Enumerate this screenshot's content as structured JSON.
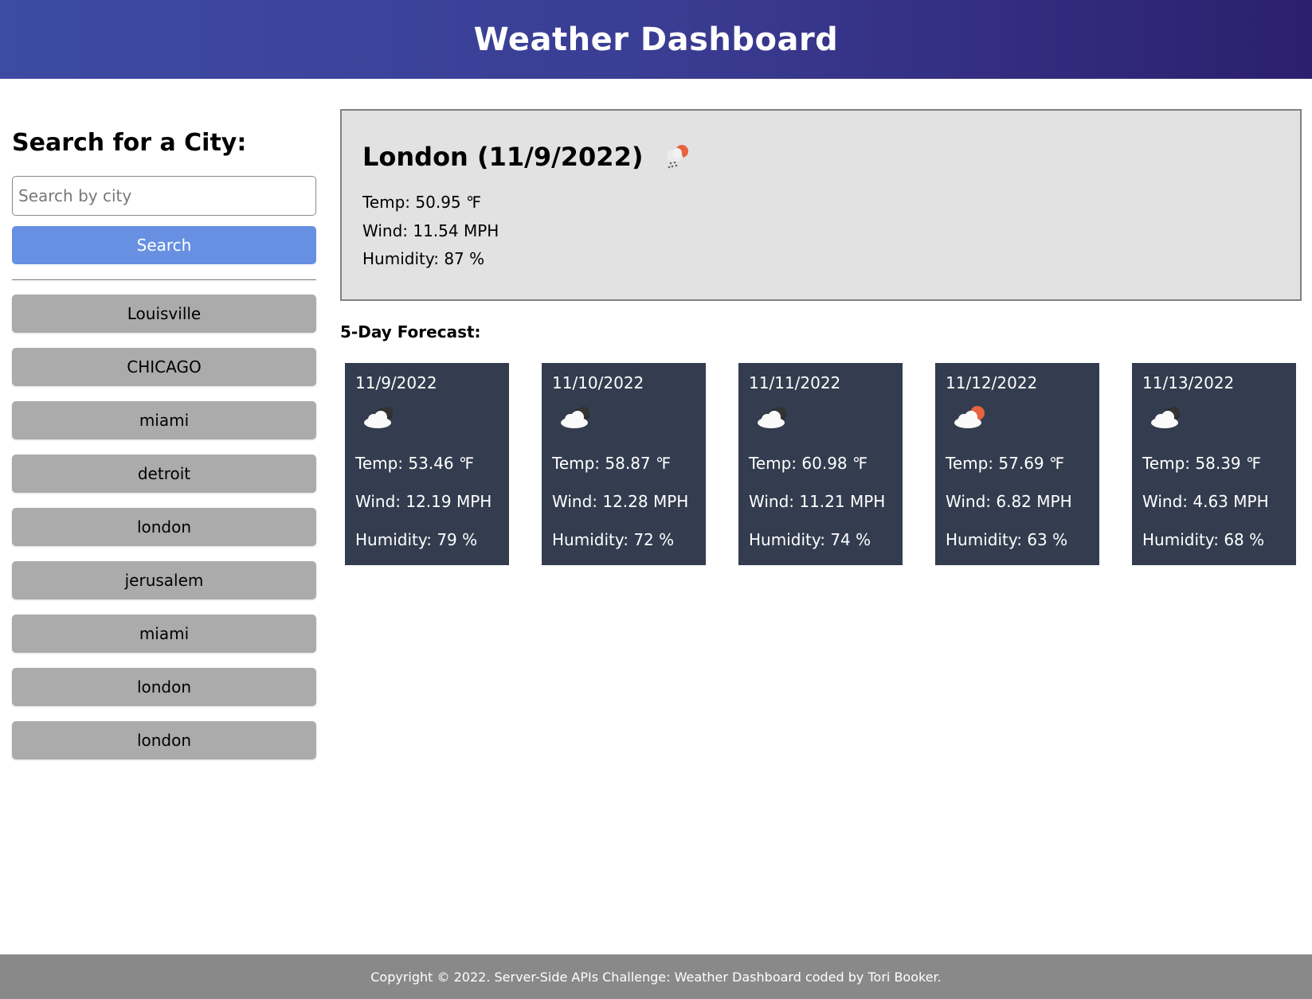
{
  "header": {
    "title": "Weather Dashboard"
  },
  "sidebar": {
    "heading": "Search for a City:",
    "search_placeholder": "Search by city",
    "search_value": "",
    "search_button": "Search",
    "history": [
      "Louisville",
      "CHICAGO",
      "miami",
      "detroit",
      "london",
      "jerusalem",
      "miami",
      "london",
      "london"
    ]
  },
  "current": {
    "title": "London (11/9/2022)",
    "icon": "rain-cloud-sun-icon",
    "temp": "Temp: 50.95 ℉",
    "wind": "Wind: 11.54 MPH",
    "humidity": "Humidity: 87 %"
  },
  "forecast": {
    "heading": "5-Day Forecast:",
    "days": [
      {
        "date": "11/9/2022",
        "icon": "broken-clouds-icon",
        "temp": "Temp: 53.46 ℉",
        "wind": "Wind: 12.19 MPH",
        "humidity": "Humidity: 79 %"
      },
      {
        "date": "11/10/2022",
        "icon": "broken-clouds-icon",
        "temp": "Temp: 58.87 ℉",
        "wind": "Wind: 12.28 MPH",
        "humidity": "Humidity: 72 %"
      },
      {
        "date": "11/11/2022",
        "icon": "broken-clouds-icon",
        "temp": "Temp: 60.98 ℉",
        "wind": "Wind: 11.21 MPH",
        "humidity": "Humidity: 74 %"
      },
      {
        "date": "11/12/2022",
        "icon": "few-clouds-sun-icon",
        "temp": "Temp: 57.69 ℉",
        "wind": "Wind: 6.82 MPH",
        "humidity": "Humidity: 63 %"
      },
      {
        "date": "11/13/2022",
        "icon": "broken-clouds-icon",
        "temp": "Temp: 58.39 ℉",
        "wind": "Wind: 4.63 MPH",
        "humidity": "Humidity: 68 %"
      }
    ]
  },
  "footer": {
    "text": "Copyright © 2022. Server-Side APIs Challenge: Weather Dashboard coded by Tori Booker."
  },
  "colors": {
    "header_gradient_start": "#3d4ba3",
    "header_gradient_end": "#2c1f6e",
    "search_button": "#6790e2",
    "history_button": "#ababab",
    "current_bg": "#e2e2e2",
    "card_bg": "#333d4f",
    "footer_bg": "#898989",
    "sun": "#e8633f"
  }
}
